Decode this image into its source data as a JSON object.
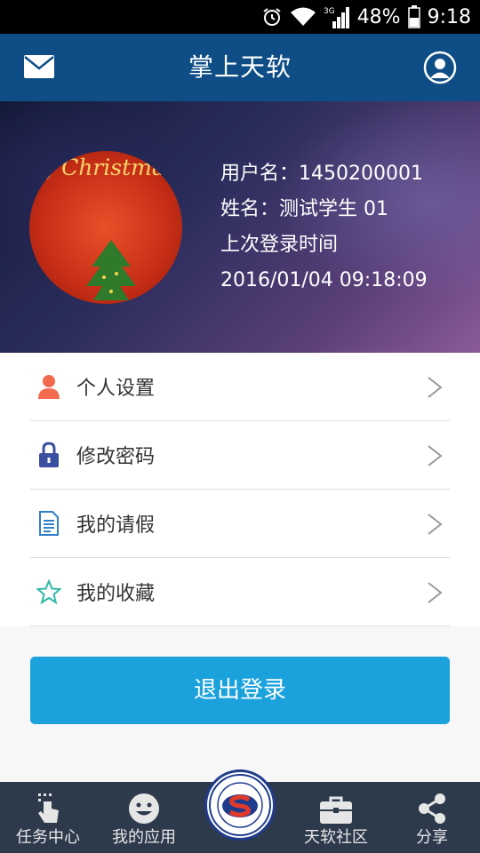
{
  "status_bar": {
    "battery": "48%",
    "time": "9:18",
    "network": "3G"
  },
  "header": {
    "title": "掌上天软"
  },
  "profile": {
    "avatar_text": "y Christmas",
    "username_line": "用户名：1450200001",
    "name_line": "姓名：测试学生 01",
    "last_login_label": "上次登录时间",
    "last_login_time": "2016/01/04 09:18:09"
  },
  "menu": {
    "items": [
      {
        "label": "个人设置",
        "icon": "person-icon",
        "color": "#f26b4f"
      },
      {
        "label": "修改密码",
        "icon": "lock-icon",
        "color": "#3a4fa0"
      },
      {
        "label": "我的请假",
        "icon": "document-icon",
        "color": "#2f7fc8"
      },
      {
        "label": "我的收藏",
        "icon": "star-icon",
        "color": "#2fb8a8"
      }
    ]
  },
  "logout_label": "退出登录",
  "bottom_nav": {
    "tabs": [
      {
        "label": "任务中心",
        "icon": "touch-icon"
      },
      {
        "label": "我的应用",
        "icon": "smiley-icon"
      },
      {
        "label": "天软社区",
        "icon": "briefcase-icon"
      },
      {
        "label": "分享",
        "icon": "share-icon"
      }
    ]
  },
  "colors": {
    "header": "#0e4d86",
    "logout_button": "#1ba2dc",
    "bottom_nav": "#2d3a4c"
  }
}
